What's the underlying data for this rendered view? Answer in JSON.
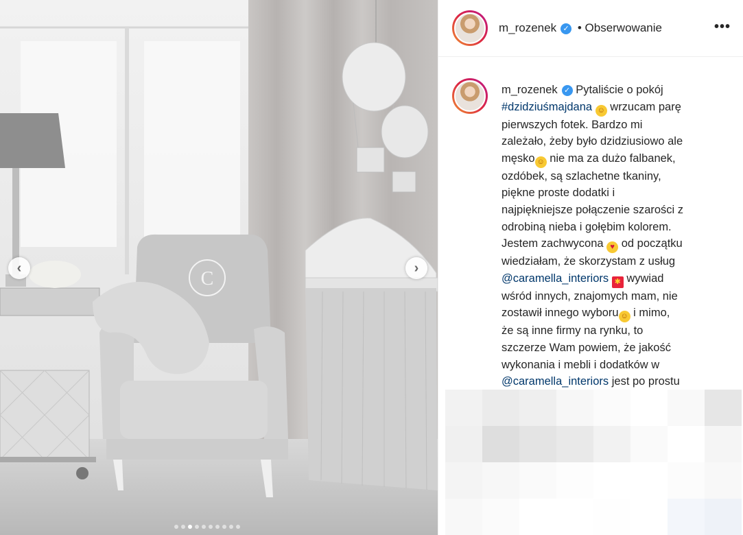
{
  "post": {
    "username": "m_rozenek",
    "follow_label": "Obserwowanie",
    "more_label": "•••",
    "verified_icon": "verified-badge-icon",
    "caption": {
      "line1": " Pytaliście o pokój",
      "hashtag": "#dzidziuśmajdana",
      "line2": " wrzucam parę",
      "line3": "pierwszych fotek. Bardzo mi",
      "line4": "zależało, żeby było dzidziusiowo ale",
      "line5a": "męsko",
      "line5b": " nie ma za dużo falbanek,",
      "line6": "ozdóbek, są szlachetne tkaniny,",
      "line7": "piękne proste dodatki i",
      "line8": "najpiękniejsze połączenie szarości z",
      "line9": "odrobiną nieba i gołębim kolorem.",
      "line10a": "Jestem zachwycona ",
      "line10b": " od początku",
      "line11": "wiedziałam, że skorzystam z usług",
      "mention1": "@caramella_interiors",
      "line12b": " wywiad",
      "line13": "wśród innych, znajomych mam, nie",
      "line14a": "zostawił innego wyboru",
      "line14b": " i mimo,",
      "line15": "że są inne firmy na rynku, to",
      "line16": "szczerze Wam powiem, że jakość",
      "line17": "wykonania i mebli i dodatków w",
      "mention2": "@caramella_interiors",
      "line18b": " jest po prostu"
    }
  },
  "carousel": {
    "prev_icon": "chevron-left-icon",
    "next_icon": "chevron-right-icon",
    "prev_glyph": "‹",
    "next_glyph": "›",
    "slide_count": 10,
    "active_slide": 2
  },
  "colors": {
    "hashtag": "#00376b",
    "verified": "#3897f0",
    "text": "#262626"
  }
}
